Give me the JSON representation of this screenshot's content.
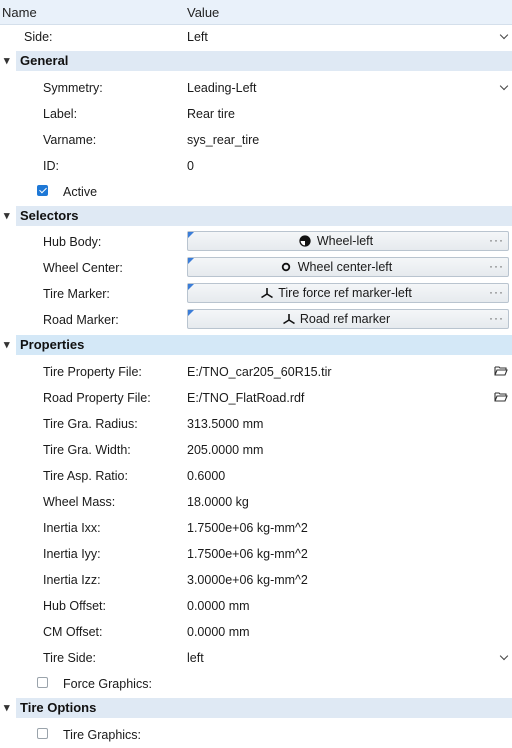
{
  "header": {
    "name_col": "Name",
    "value_col": "Value"
  },
  "side": {
    "label": "Side:",
    "value": "Left"
  },
  "general": {
    "title": "General",
    "symmetry": {
      "label": "Symmetry:",
      "value": "Leading-Left"
    },
    "label_row": {
      "label": "Label:",
      "value": "Rear tire"
    },
    "varname": {
      "label": "Varname:",
      "value": "sys_rear_tire"
    },
    "id": {
      "label": "ID:",
      "value": "0"
    },
    "active": {
      "label": "Active",
      "checked": true
    }
  },
  "selectors": {
    "title": "Selectors",
    "hub_body": {
      "label": "Hub Body:",
      "value": "Wheel-left",
      "icon": "body-icon"
    },
    "wheel_center": {
      "label": "Wheel Center:",
      "value": "Wheel center-left",
      "icon": "point-icon"
    },
    "tire_marker": {
      "label": "Tire Marker:",
      "value": "Tire force ref marker-left",
      "icon": "marker-icon"
    },
    "road_marker": {
      "label": "Road Marker:",
      "value": "Road ref marker",
      "icon": "marker-icon"
    },
    "more": "···"
  },
  "properties": {
    "title": "Properties",
    "tire_property_file": {
      "label": "Tire Property File:",
      "value": "E:/TNO_car205_60R15.tir"
    },
    "road_property_file": {
      "label": "Road Property File:",
      "value": "E:/TNO_FlatRoad.rdf"
    },
    "radius": {
      "label": "Tire Gra. Radius:",
      "value": "313.5000 mm"
    },
    "width": {
      "label": "Tire Gra. Width:",
      "value": "205.0000 mm"
    },
    "aspect": {
      "label": "Tire Asp. Ratio:",
      "value": "0.6000"
    },
    "mass": {
      "label": "Wheel Mass:",
      "value": "18.0000 kg"
    },
    "ixx": {
      "label": "Inertia Ixx:",
      "value": "1.7500e+06 kg-mm^2"
    },
    "iyy": {
      "label": "Inertia Iyy:",
      "value": "1.7500e+06 kg-mm^2"
    },
    "izz": {
      "label": "Inertia Izz:",
      "value": "3.0000e+06 kg-mm^2"
    },
    "hub_offset": {
      "label": "Hub Offset:",
      "value": "0.0000 mm"
    },
    "cm_offset": {
      "label": "CM Offset:",
      "value": "0.0000 mm"
    },
    "tire_side": {
      "label": "Tire Side:",
      "value": "left"
    },
    "force_graphics": {
      "label": "Force Graphics:",
      "checked": false
    }
  },
  "tire_options": {
    "title": "Tire Options",
    "tire_graphics": {
      "label": "Tire Graphics:",
      "checked": false
    }
  },
  "colors": {
    "accent": "#1e78d6",
    "section_band": "#dfe9f4",
    "header": "#e9f1fa"
  }
}
